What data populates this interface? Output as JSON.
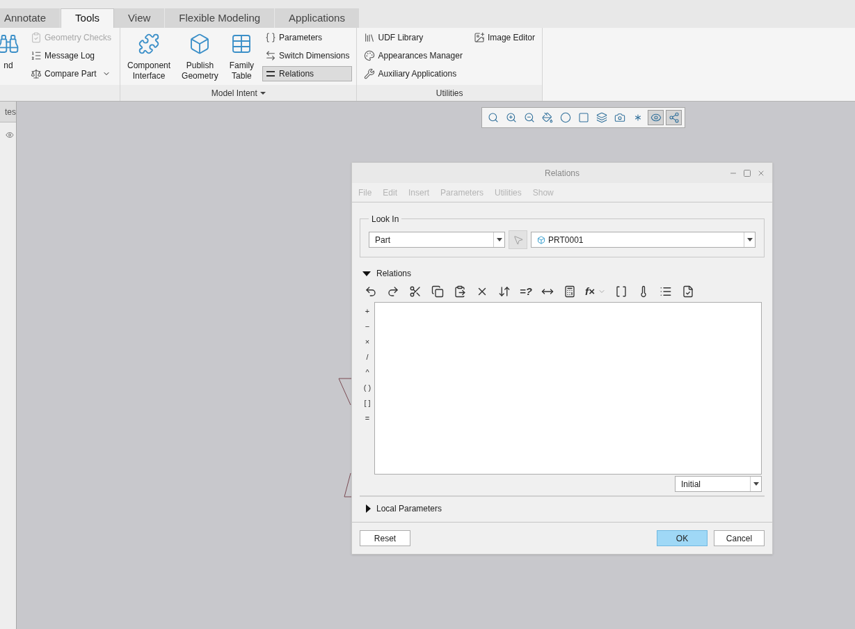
{
  "ribbon_tabs": [
    {
      "label": "Annotate",
      "selected": false
    },
    {
      "label": "Tools",
      "selected": true
    },
    {
      "label": "View",
      "selected": false
    },
    {
      "label": "Flexible Modeling",
      "selected": false
    },
    {
      "label": "Applications",
      "selected": false
    }
  ],
  "ribbon_groups": [
    {
      "columns": [
        [
          {
            "kind": "large",
            "label": "nd",
            "disabled": false,
            "selected": false,
            "dropdown": false
          }
        ],
        [
          {
            "kind": "small",
            "label": "Geometry Checks",
            "disabled": true,
            "selected": false,
            "dropdown": false
          },
          {
            "kind": "small",
            "label": "Message Log",
            "disabled": false,
            "selected": false,
            "dropdown": false
          },
          {
            "kind": "small",
            "label": "Compare Part",
            "disabled": false,
            "selected": false,
            "dropdown": true
          }
        ]
      ]
    },
    {
      "label": "Model Intent",
      "label_dropdown": true,
      "columns": [
        [
          {
            "kind": "large",
            "label": "Component Interface",
            "disabled": false,
            "selected": false,
            "dropdown": false
          }
        ],
        [
          {
            "kind": "large",
            "label": "Publish Geometry",
            "disabled": false,
            "selected": false,
            "dropdown": false
          }
        ],
        [
          {
            "kind": "large",
            "label": "Family Table",
            "disabled": false,
            "selected": false,
            "dropdown": false
          }
        ],
        [
          {
            "kind": "small",
            "label": "Parameters",
            "disabled": false,
            "selected": false,
            "dropdown": false
          },
          {
            "kind": "small",
            "label": "Switch Dimensions",
            "disabled": false,
            "selected": false,
            "dropdown": false
          },
          {
            "kind": "small",
            "label": "Relations",
            "disabled": false,
            "selected": true,
            "dropdown": false
          }
        ]
      ]
    },
    {
      "label": "Utilities",
      "label_dropdown": false,
      "columns": [
        [
          {
            "kind": "small",
            "label": "UDF Library",
            "disabled": false,
            "selected": false,
            "dropdown": false
          },
          {
            "kind": "small",
            "label": "Appearances Manager",
            "disabled": false,
            "selected": false,
            "dropdown": false
          },
          {
            "kind": "small",
            "label": "Auxiliary Applications",
            "disabled": false,
            "selected": false,
            "dropdown": false
          }
        ],
        [
          {
            "kind": "small",
            "label": "Image Editor",
            "disabled": false,
            "selected": false,
            "dropdown": false
          }
        ]
      ]
    }
  ],
  "left_panel": {
    "tab": "tes"
  },
  "view_toolbar": [
    {
      "kind": "zoom-fit",
      "on": false
    },
    {
      "kind": "zoom-in",
      "on": false
    },
    {
      "kind": "zoom-out",
      "on": false
    },
    {
      "kind": "repaint",
      "on": false
    },
    {
      "kind": "shading",
      "on": false
    },
    {
      "kind": "view",
      "on": false
    },
    {
      "kind": "saved-views",
      "on": false
    },
    {
      "kind": "snapshot",
      "on": false
    },
    {
      "kind": "datum",
      "on": false
    },
    {
      "kind": "annotation",
      "on": true
    },
    {
      "kind": "spin-center",
      "on": true
    }
  ],
  "dialog": {
    "title": "Relations",
    "menu": [
      {
        "label": "File",
        "disabled": true
      },
      {
        "label": "Edit",
        "disabled": true
      },
      {
        "label": "Insert",
        "disabled": true
      },
      {
        "label": "Parameters",
        "disabled": true
      },
      {
        "label": "Utilities",
        "disabled": true
      },
      {
        "label": "Show",
        "disabled": true
      }
    ],
    "look_in": {
      "label": "Look In",
      "type": "Part",
      "object": "PRT0001"
    },
    "relations": {
      "label": "Relations",
      "expanded": true,
      "toolbar": [
        {
          "kind": "undo"
        },
        {
          "kind": "redo"
        },
        {
          "kind": "cut"
        },
        {
          "kind": "copy"
        },
        {
          "kind": "paste"
        },
        {
          "kind": "delete"
        },
        {
          "kind": "sort"
        },
        {
          "kind": "glyph",
          "text": "=?"
        },
        {
          "kind": "dimension"
        },
        {
          "kind": "evaluate"
        },
        {
          "kind": "glyph",
          "text": "f×",
          "dropdown": true
        },
        {
          "kind": "brackets"
        },
        {
          "kind": "units"
        },
        {
          "kind": "list"
        },
        {
          "kind": "verify"
        }
      ],
      "operators": [
        "+",
        "−",
        "×",
        "/",
        "^",
        "( )",
        "[ ]",
        "="
      ],
      "units": "Initial"
    },
    "local_parameters": {
      "label": "Local Parameters",
      "expanded": false
    },
    "buttons": [
      {
        "label": "Reset",
        "default": false
      },
      {
        "label": "OK",
        "default": true
      },
      {
        "label": "Cancel",
        "default": false
      }
    ]
  }
}
